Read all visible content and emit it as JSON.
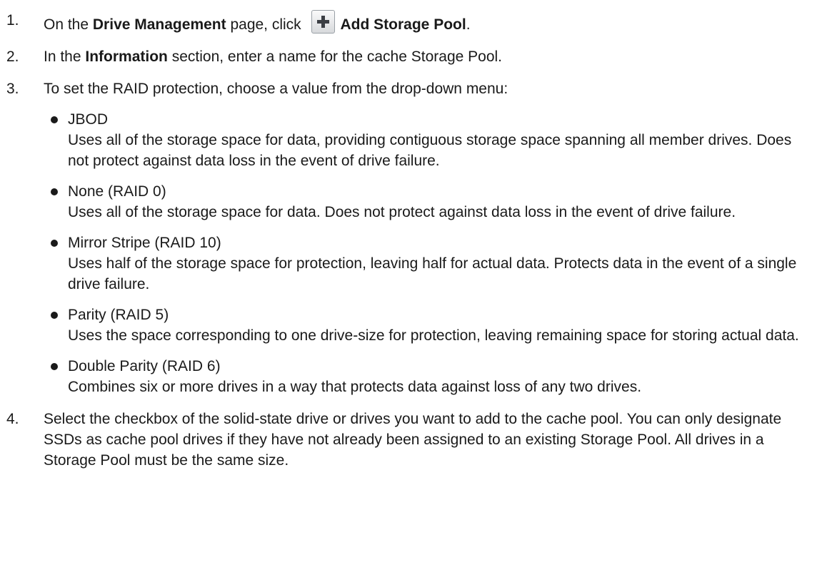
{
  "steps": [
    {
      "num": "1.",
      "before": "On the ",
      "bold": "Drive Management",
      "middle": " page, click ",
      "icon": "plus-icon",
      "action": "Add Storage Pool",
      "after": "."
    },
    {
      "num": "2.",
      "before": "In the ",
      "bold": "Information",
      "after": " section, enter a name for the cache Storage Pool."
    },
    {
      "num": "3.",
      "text": "To set the RAID protection, choose a value from the drop-down menu:",
      "options": [
        {
          "title": "JBOD",
          "desc": "Uses all of the storage space for data, providing contiguous storage space spanning all member drives. Does not protect against data loss in the event of drive failure."
        },
        {
          "title": "None (RAID 0)",
          "desc": "Uses all of the storage space for data. Does not protect against data loss in the event of drive failure."
        },
        {
          "title": "Mirror Stripe (RAID 10)",
          "desc": "Uses half of the storage space for protection, leaving half for actual data. Protects data in the event of a single drive failure."
        },
        {
          "title": "Parity (RAID 5)",
          "desc": "Uses the space corresponding to one drive-size for protection, leaving remaining space for storing actual data."
        },
        {
          "title": "Double Parity (RAID 6)",
          "desc": "Combines six or more drives in a way that protects data against loss of any two drives."
        }
      ]
    },
    {
      "num": "4.",
      "text": "Select the checkbox of the solid-state drive or drives you want to add to the cache pool. You can only designate SSDs as cache pool drives if they have not already been assigned to an existing Storage Pool. All drives in a Storage Pool must be the same size."
    }
  ]
}
